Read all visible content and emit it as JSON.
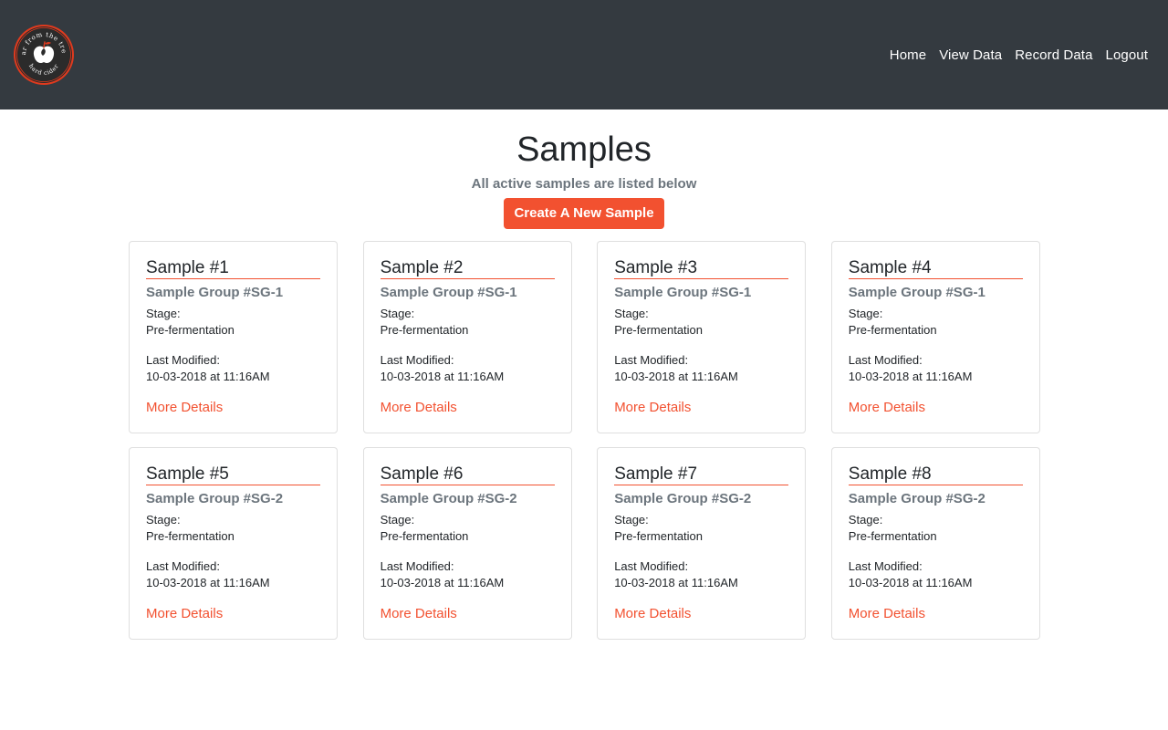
{
  "nav": {
    "logo_text_top": "far from the tree",
    "logo_text_bottom": "hard cider",
    "links": [
      "Home",
      "View Data",
      "Record Data",
      "Logout"
    ]
  },
  "header": {
    "title": "Samples",
    "subtitle": "All active samples are listed below",
    "create_button": "Create A New Sample"
  },
  "labels": {
    "stage": "Stage:",
    "last_modified": "Last Modified:",
    "more_details": "More Details"
  },
  "samples": [
    {
      "title": "Sample #1",
      "group": "Sample Group #SG-1",
      "stage": "Pre-fermentation",
      "modified": "10-03-2018 at 11:16AM"
    },
    {
      "title": "Sample #2",
      "group": "Sample Group #SG-1",
      "stage": "Pre-fermentation",
      "modified": "10-03-2018 at 11:16AM"
    },
    {
      "title": "Sample #3",
      "group": "Sample Group #SG-1",
      "stage": "Pre-fermentation",
      "modified": "10-03-2018 at 11:16AM"
    },
    {
      "title": "Sample #4",
      "group": "Sample Group #SG-1",
      "stage": "Pre-fermentation",
      "modified": "10-03-2018 at 11:16AM"
    },
    {
      "title": "Sample #5",
      "group": "Sample Group #SG-2",
      "stage": "Pre-fermentation",
      "modified": "10-03-2018 at 11:16AM"
    },
    {
      "title": "Sample #6",
      "group": "Sample Group #SG-2",
      "stage": "Pre-fermentation",
      "modified": "10-03-2018 at 11:16AM"
    },
    {
      "title": "Sample #7",
      "group": "Sample Group #SG-2",
      "stage": "Pre-fermentation",
      "modified": "10-03-2018 at 11:16AM"
    },
    {
      "title": "Sample #8",
      "group": "Sample Group #SG-2",
      "stage": "Pre-fermentation",
      "modified": "10-03-2018 at 11:16AM"
    }
  ],
  "colors": {
    "navbar": "#343a40",
    "accent": "#f25130",
    "muted": "#6c757d"
  }
}
